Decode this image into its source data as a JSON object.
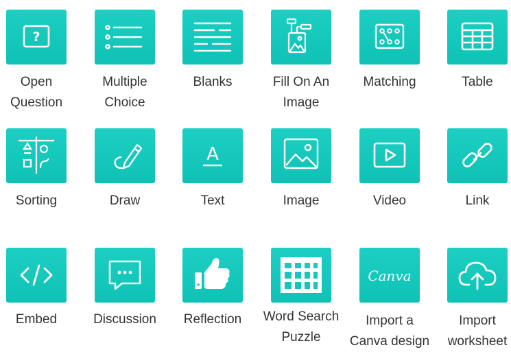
{
  "items": [
    {
      "label": "Open\nQuestion",
      "icon": "question-box-icon"
    },
    {
      "label": "Multiple\nChoice",
      "icon": "bulleted-list-icon"
    },
    {
      "label": "Blanks",
      "icon": "text-lines-icon"
    },
    {
      "label": "Fill On An\nImage",
      "icon": "image-labels-icon"
    },
    {
      "label": "Matching",
      "icon": "matching-dots-icon"
    },
    {
      "label": "Table",
      "icon": "table-icon"
    },
    {
      "label": "Sorting",
      "icon": "sorting-shapes-icon"
    },
    {
      "label": "Draw",
      "icon": "pencil-icon"
    },
    {
      "label": "Text",
      "icon": "text-a-icon"
    },
    {
      "label": "Image",
      "icon": "image-icon"
    },
    {
      "label": "Video",
      "icon": "video-play-icon"
    },
    {
      "label": "Link",
      "icon": "chain-link-icon"
    },
    {
      "label": "Embed",
      "icon": "code-brackets-icon"
    },
    {
      "label": "Discussion",
      "icon": "speech-bubble-icon"
    },
    {
      "label": "Reflection",
      "icon": "thumbs-up-icon"
    },
    {
      "label": "Word Search\nPuzzle",
      "icon": "grid-icon"
    },
    {
      "label": "Import a\nCanva design",
      "icon": "canva-logo-icon",
      "logo_text": "Canva"
    },
    {
      "label": "Import\nworksheet",
      "icon": "cloud-upload-icon"
    }
  ],
  "colors": {
    "tile": "#13c8bb",
    "icon": "#ffffff",
    "text": "#333333"
  }
}
